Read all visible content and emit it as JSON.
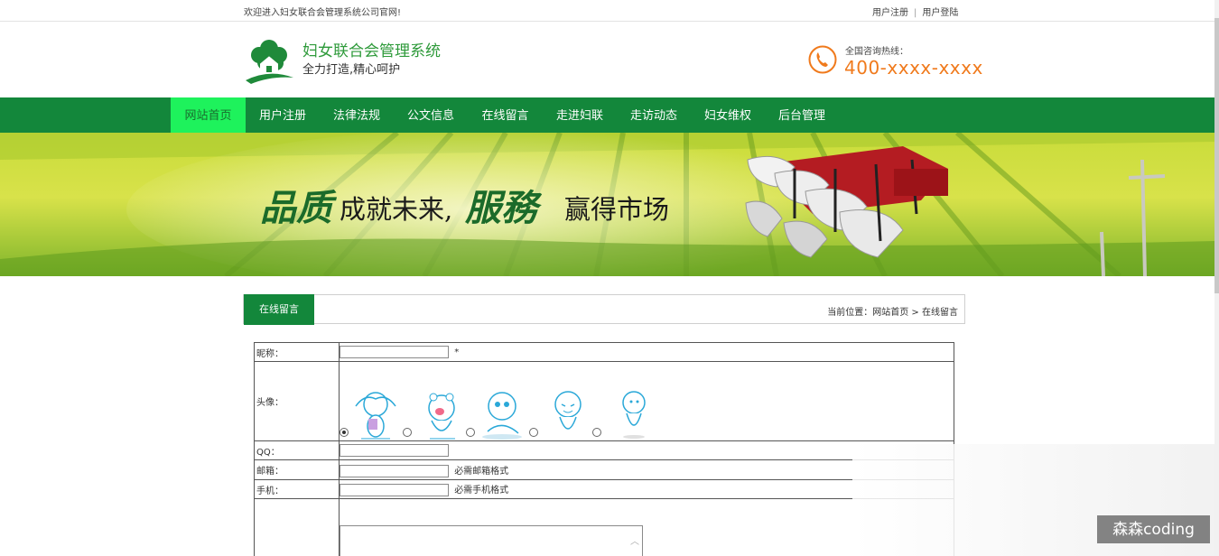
{
  "topbar": {
    "welcome": "欢迎进入妇女联合会管理系统公司官网!",
    "register": "用户注册",
    "separator": "|",
    "login": "用户登陆"
  },
  "header": {
    "title": "妇女联合会管理系统",
    "subtitle": "全力打造,精心呵护",
    "hotline_label": "全国咨询热线：",
    "hotline_number": "400-xxxx-xxxx"
  },
  "nav": {
    "items": [
      {
        "label": "网站首页",
        "active": true
      },
      {
        "label": "用户注册",
        "active": false
      },
      {
        "label": "法律法规",
        "active": false
      },
      {
        "label": "公文信息",
        "active": false
      },
      {
        "label": "在线留言",
        "active": false
      },
      {
        "label": "走进妇联",
        "active": false
      },
      {
        "label": "走访动态",
        "active": false
      },
      {
        "label": "妇女维权",
        "active": false
      },
      {
        "label": "后台管理",
        "active": false
      }
    ]
  },
  "banner": {
    "slogan_big_1": "品质",
    "slogan_small_1": "成就未来,",
    "slogan_big_2": "服務",
    "slogan_small_2": "赢得市场"
  },
  "section": {
    "tab": "在线留言",
    "breadcrumb": "当前位置：网站首页 > 在线留言"
  },
  "form": {
    "nickname_label": "昵称：",
    "nickname_required": "*",
    "avatar_label": "头像：",
    "qq_label": "QQ：",
    "email_label": "邮箱：",
    "email_hint": "必需邮箱格式",
    "phone_label": "手机：",
    "phone_hint": "必需手机格式"
  },
  "watermark": "森森coding",
  "colors": {
    "brand_green": "#13873b",
    "active_nav": "#1ef25c",
    "hotline_orange": "#f07a1c"
  }
}
